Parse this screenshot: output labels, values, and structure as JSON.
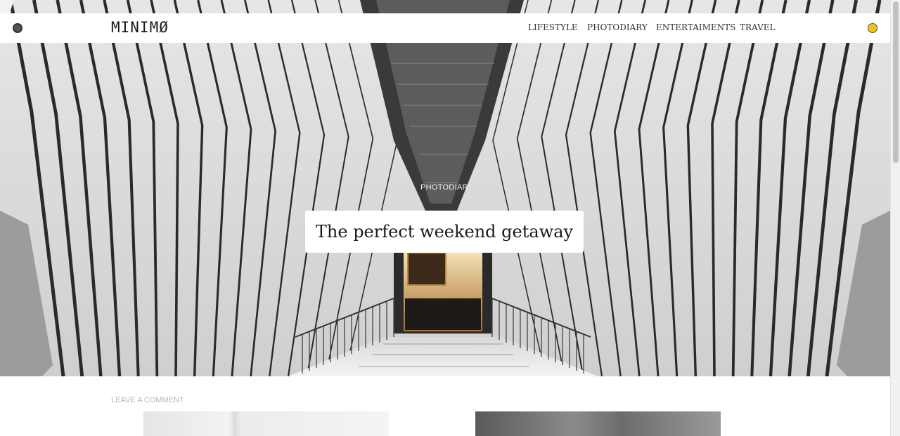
{
  "header": {
    "logo": "MINIMØ",
    "nav": [
      "LIFESTYLE",
      "PHOTODIARY",
      "ENTERTAIMENTS",
      "TRAVEL"
    ]
  },
  "hero": {
    "category": "PHOTODIARY",
    "title": "The perfect weekend getaway"
  },
  "post_meta": {
    "comment_link": "LEAVE A COMMENT"
  },
  "colors": {
    "accent_dot": "#f0c419",
    "dark_dot": "#555555"
  }
}
